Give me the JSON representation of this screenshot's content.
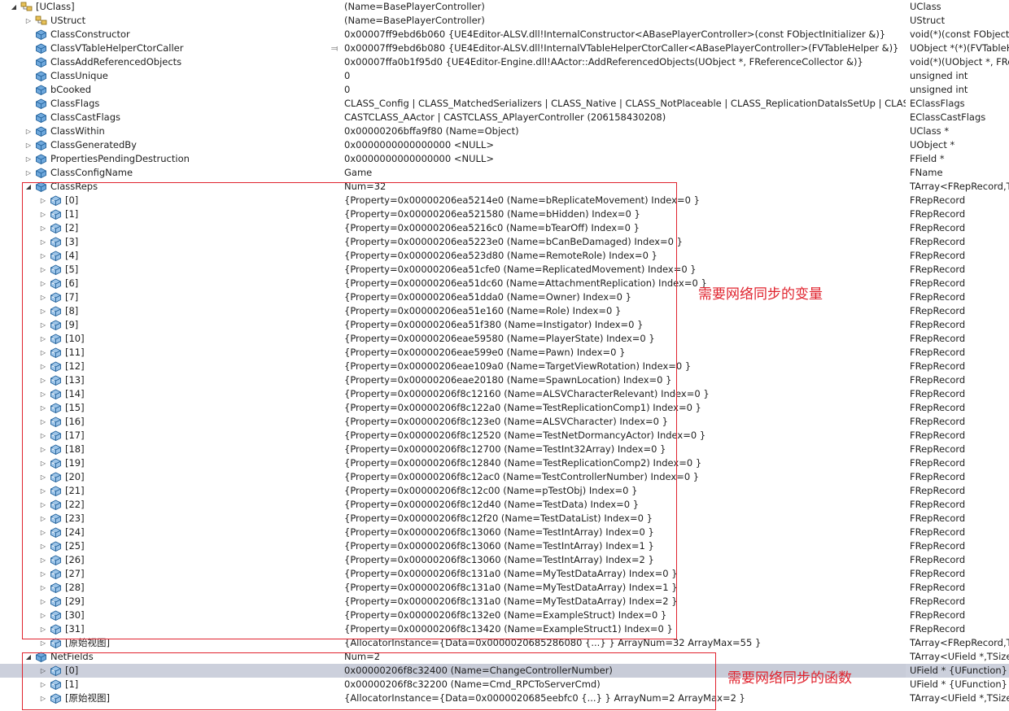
{
  "colors": {
    "annotation": "#e0232e",
    "selection": "#ccd0dc",
    "icon": "#3b7fc4"
  },
  "rows": [
    {
      "depth": 0,
      "exp": "open",
      "icon": "class-icon",
      "name": "[UClass]",
      "value": "(Name=BasePlayerController)",
      "type": "UClass"
    },
    {
      "depth": 1,
      "exp": "closed",
      "icon": "class-icon",
      "name": "UStruct",
      "value": "(Name=BasePlayerController)",
      "type": "UStruct"
    },
    {
      "depth": 1,
      "exp": "",
      "icon": "field-icon",
      "name": "ClassConstructor",
      "value": "0x00007ff9ebd6b060 {UE4Editor-ALSV.dll!InternalConstructor<ABasePlayerController>(const FObjectInitializer &)}",
      "type": "void(*)(const FObjectIn"
    },
    {
      "depth": 1,
      "exp": "",
      "icon": "field-icon",
      "name": "ClassVTableHelperCtorCaller",
      "pin": true,
      "value": "0x00007ff9ebd6b080 {UE4Editor-ALSV.dll!InternalVTableHelperCtorCaller<ABasePlayerController>(FVTableHelper &)}",
      "type": "UObject *(*)(FVTableHe"
    },
    {
      "depth": 1,
      "exp": "",
      "icon": "field-icon",
      "name": "ClassAddReferencedObjects",
      "value": "0x00007ffa0b1f95d0 {UE4Editor-Engine.dll!AActor::AddReferencedObjects(UObject *, FReferenceCollector &)}",
      "type": "void(*)(UObject *, FRef"
    },
    {
      "depth": 1,
      "exp": "",
      "icon": "field-icon",
      "name": "ClassUnique",
      "value": "0",
      "type": "unsigned int"
    },
    {
      "depth": 1,
      "exp": "",
      "icon": "field-icon",
      "name": "bCooked",
      "value": "0",
      "type": "unsigned int"
    },
    {
      "depth": 1,
      "exp": "",
      "icon": "field-icon",
      "name": "ClassFlags",
      "value": "CLASS_Config | CLASS_MatchedSerializers | CLASS_Native | CLASS_NotPlaceable | CLASS_ReplicationDataIsSetUp | CLASS_TokenSt...",
      "type": "EClassFlags"
    },
    {
      "depth": 1,
      "exp": "",
      "icon": "field-icon",
      "name": "ClassCastFlags",
      "value": "CASTCLASS_AActor | CASTCLASS_APlayerController (206158430208)",
      "type": "EClassCastFlags"
    },
    {
      "depth": 1,
      "exp": "closed",
      "icon": "field-icon",
      "name": "ClassWithin",
      "value": "0x00000206bffa9f80 (Name=Object)",
      "type": "UClass *"
    },
    {
      "depth": 1,
      "exp": "closed",
      "icon": "field-icon",
      "name": "ClassGeneratedBy",
      "value": "0x0000000000000000 <NULL>",
      "type": "UObject *"
    },
    {
      "depth": 1,
      "exp": "closed",
      "icon": "field-icon",
      "name": "PropertiesPendingDestruction",
      "value": "0x0000000000000000 <NULL>",
      "type": "FField *"
    },
    {
      "depth": 1,
      "exp": "closed",
      "icon": "field-icon",
      "name": "ClassConfigName",
      "value": "Game",
      "type": "FName"
    },
    {
      "depth": 1,
      "exp": "open",
      "icon": "field-icon",
      "name": "ClassReps",
      "value": "Num=32",
      "type": "TArray<FRepRecord,TSi"
    },
    {
      "depth": 2,
      "exp": "closed",
      "icon": "element-icon",
      "name": "[0]",
      "value": "{Property=0x00000206ea5214e0 (Name=bReplicateMovement) Index=0 }",
      "type": "FRepRecord"
    },
    {
      "depth": 2,
      "exp": "closed",
      "icon": "element-icon",
      "name": "[1]",
      "value": "{Property=0x00000206ea521580 (Name=bHidden) Index=0 }",
      "type": "FRepRecord"
    },
    {
      "depth": 2,
      "exp": "closed",
      "icon": "element-icon",
      "name": "[2]",
      "value": "{Property=0x00000206ea5216c0 (Name=bTearOff) Index=0 }",
      "type": "FRepRecord"
    },
    {
      "depth": 2,
      "exp": "closed",
      "icon": "element-icon",
      "name": "[3]",
      "value": "{Property=0x00000206ea5223e0 (Name=bCanBeDamaged) Index=0 }",
      "type": "FRepRecord"
    },
    {
      "depth": 2,
      "exp": "closed",
      "icon": "element-icon",
      "name": "[4]",
      "value": "{Property=0x00000206ea523d80 (Name=RemoteRole) Index=0 }",
      "type": "FRepRecord"
    },
    {
      "depth": 2,
      "exp": "closed",
      "icon": "element-icon",
      "name": "[5]",
      "value": "{Property=0x00000206ea51cfe0 (Name=ReplicatedMovement) Index=0 }",
      "type": "FRepRecord"
    },
    {
      "depth": 2,
      "exp": "closed",
      "icon": "element-icon",
      "name": "[6]",
      "value": "{Property=0x00000206ea51dc60 (Name=AttachmentReplication) Index=0 }",
      "type": "FRepRecord"
    },
    {
      "depth": 2,
      "exp": "closed",
      "icon": "element-icon",
      "name": "[7]",
      "value": "{Property=0x00000206ea51dda0 (Name=Owner) Index=0 }",
      "type": "FRepRecord"
    },
    {
      "depth": 2,
      "exp": "closed",
      "icon": "element-icon",
      "name": "[8]",
      "value": "{Property=0x00000206ea51e160 (Name=Role) Index=0 }",
      "type": "FRepRecord"
    },
    {
      "depth": 2,
      "exp": "closed",
      "icon": "element-icon",
      "name": "[9]",
      "value": "{Property=0x00000206ea51f380 (Name=Instigator) Index=0 }",
      "type": "FRepRecord"
    },
    {
      "depth": 2,
      "exp": "closed",
      "icon": "element-icon",
      "name": "[10]",
      "value": "{Property=0x00000206eae59580 (Name=PlayerState) Index=0 }",
      "type": "FRepRecord"
    },
    {
      "depth": 2,
      "exp": "closed",
      "icon": "element-icon",
      "name": "[11]",
      "value": "{Property=0x00000206eae599e0 (Name=Pawn) Index=0 }",
      "type": "FRepRecord"
    },
    {
      "depth": 2,
      "exp": "closed",
      "icon": "element-icon",
      "name": "[12]",
      "value": "{Property=0x00000206eae109a0 (Name=TargetViewRotation) Index=0 }",
      "type": "FRepRecord"
    },
    {
      "depth": 2,
      "exp": "closed",
      "icon": "element-icon",
      "name": "[13]",
      "value": "{Property=0x00000206eae20180 (Name=SpawnLocation) Index=0 }",
      "type": "FRepRecord"
    },
    {
      "depth": 2,
      "exp": "closed",
      "icon": "element-icon",
      "name": "[14]",
      "value": "{Property=0x00000206f8c12160 (Name=ALSVCharacterRelevant) Index=0 }",
      "type": "FRepRecord"
    },
    {
      "depth": 2,
      "exp": "closed",
      "icon": "element-icon",
      "name": "[15]",
      "value": "{Property=0x00000206f8c122a0 (Name=TestReplicationComp1) Index=0 }",
      "type": "FRepRecord"
    },
    {
      "depth": 2,
      "exp": "closed",
      "icon": "element-icon",
      "name": "[16]",
      "value": "{Property=0x00000206f8c123e0 (Name=ALSVCharacter) Index=0 }",
      "type": "FRepRecord"
    },
    {
      "depth": 2,
      "exp": "closed",
      "icon": "element-icon",
      "name": "[17]",
      "value": "{Property=0x00000206f8c12520 (Name=TestNetDormancyActor) Index=0 }",
      "type": "FRepRecord"
    },
    {
      "depth": 2,
      "exp": "closed",
      "icon": "element-icon",
      "name": "[18]",
      "value": "{Property=0x00000206f8c12700 (Name=TestInt32Array) Index=0 }",
      "type": "FRepRecord"
    },
    {
      "depth": 2,
      "exp": "closed",
      "icon": "element-icon",
      "name": "[19]",
      "value": "{Property=0x00000206f8c12840 (Name=TestReplicationComp2) Index=0 }",
      "type": "FRepRecord"
    },
    {
      "depth": 2,
      "exp": "closed",
      "icon": "element-icon",
      "name": "[20]",
      "value": "{Property=0x00000206f8c12ac0 (Name=TestControllerNumber) Index=0 }",
      "type": "FRepRecord"
    },
    {
      "depth": 2,
      "exp": "closed",
      "icon": "element-icon",
      "name": "[21]",
      "value": "{Property=0x00000206f8c12c00 (Name=pTestObj) Index=0 }",
      "type": "FRepRecord"
    },
    {
      "depth": 2,
      "exp": "closed",
      "icon": "element-icon",
      "name": "[22]",
      "value": "{Property=0x00000206f8c12d40 (Name=TestData) Index=0 }",
      "type": "FRepRecord"
    },
    {
      "depth": 2,
      "exp": "closed",
      "icon": "element-icon",
      "name": "[23]",
      "value": "{Property=0x00000206f8c12f20 (Name=TestDataList) Index=0 }",
      "type": "FRepRecord"
    },
    {
      "depth": 2,
      "exp": "closed",
      "icon": "element-icon",
      "name": "[24]",
      "value": "{Property=0x00000206f8c13060 (Name=TestIntArray) Index=0 }",
      "type": "FRepRecord"
    },
    {
      "depth": 2,
      "exp": "closed",
      "icon": "element-icon",
      "name": "[25]",
      "value": "{Property=0x00000206f8c13060 (Name=TestIntArray) Index=1 }",
      "type": "FRepRecord"
    },
    {
      "depth": 2,
      "exp": "closed",
      "icon": "element-icon",
      "name": "[26]",
      "value": "{Property=0x00000206f8c13060 (Name=TestIntArray) Index=2 }",
      "type": "FRepRecord"
    },
    {
      "depth": 2,
      "exp": "closed",
      "icon": "element-icon",
      "name": "[27]",
      "value": "{Property=0x00000206f8c131a0 (Name=MyTestDataArray) Index=0 }",
      "type": "FRepRecord"
    },
    {
      "depth": 2,
      "exp": "closed",
      "icon": "element-icon",
      "name": "[28]",
      "value": "{Property=0x00000206f8c131a0 (Name=MyTestDataArray) Index=1 }",
      "type": "FRepRecord"
    },
    {
      "depth": 2,
      "exp": "closed",
      "icon": "element-icon",
      "name": "[29]",
      "value": "{Property=0x00000206f8c131a0 (Name=MyTestDataArray) Index=2 }",
      "type": "FRepRecord"
    },
    {
      "depth": 2,
      "exp": "closed",
      "icon": "element-icon",
      "name": "[30]",
      "value": "{Property=0x00000206f8c132e0 (Name=ExampleStruct) Index=0 }",
      "type": "FRepRecord"
    },
    {
      "depth": 2,
      "exp": "closed",
      "icon": "element-icon",
      "name": "[31]",
      "value": "{Property=0x00000206f8c13420 (Name=ExampleStruct1) Index=0 }",
      "type": "FRepRecord"
    },
    {
      "depth": 2,
      "exp": "closed",
      "icon": "element-icon",
      "name": "[原始视图]",
      "value": "{AllocatorInstance={Data=0x0000020685286080 {...} } ArrayNum=32 ArrayMax=55 }",
      "type": "TArray<FRepRecord,TSi"
    },
    {
      "depth": 1,
      "exp": "open",
      "icon": "field-icon",
      "name": "NetFields",
      "value": "Num=2",
      "type": "TArray<UField *,TSizedD"
    },
    {
      "depth": 2,
      "exp": "closed",
      "icon": "element-icon",
      "name": "[0]",
      "value": "0x00000206f8c32400 (Name=ChangeControllerNumber)",
      "type": "UField * {UFunction}",
      "selected": true
    },
    {
      "depth": 2,
      "exp": "closed",
      "icon": "element-icon",
      "name": "[1]",
      "value": "0x00000206f8c32200 (Name=Cmd_RPCToServerCmd)",
      "type": "UField * {UFunction}"
    },
    {
      "depth": 2,
      "exp": "closed",
      "icon": "element-icon",
      "name": "[原始视图]",
      "value": "{AllocatorInstance={Data=0x0000020685eebfc0 {...} } ArrayNum=2 ArrayMax=2 }",
      "type": "TArray<UField *,TSizedD"
    }
  ],
  "annotations": {
    "class_reps_note": "需要网络同步的变量",
    "net_fields_note": "需要网络同步的函数"
  }
}
